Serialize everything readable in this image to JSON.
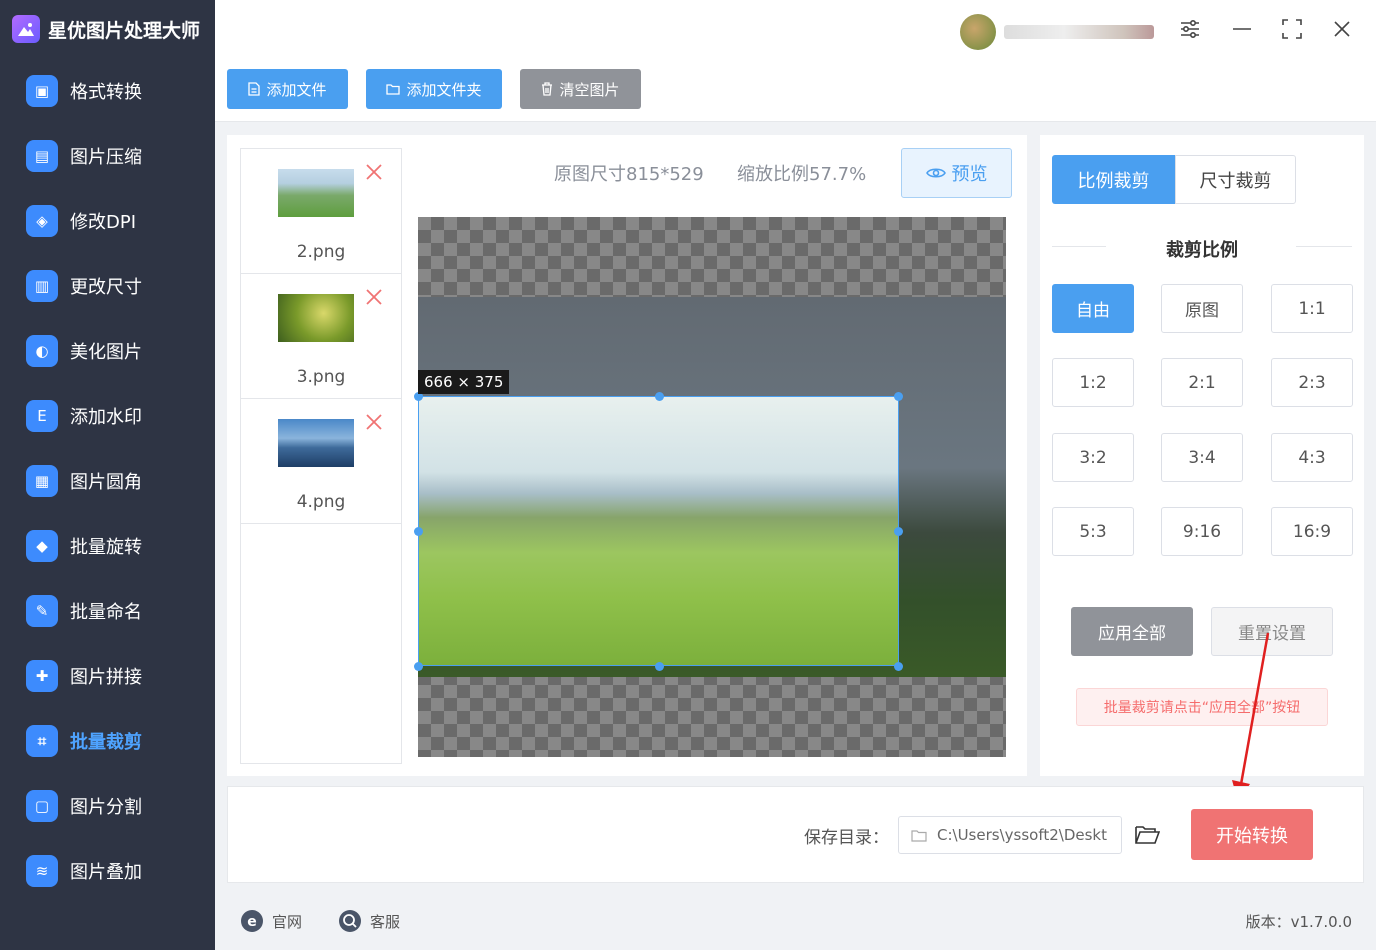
{
  "app": {
    "title": "星优图片处理大师"
  },
  "sidebar": {
    "items": [
      {
        "label": "格式转换",
        "icon": "image-convert-icon",
        "color": "#3d8bfd"
      },
      {
        "label": "图片压缩",
        "icon": "compress-icon",
        "color": "#3d8bfd"
      },
      {
        "label": "修改DPI",
        "icon": "dpi-icon",
        "color": "#3d8bfd"
      },
      {
        "label": "更改尺寸",
        "icon": "resize-icon",
        "color": "#3d8bfd"
      },
      {
        "label": "美化图片",
        "icon": "beautify-icon",
        "color": "#3d8bfd"
      },
      {
        "label": "添加水印",
        "icon": "watermark-icon",
        "color": "#3d8bfd"
      },
      {
        "label": "图片圆角",
        "icon": "round-corner-icon",
        "color": "#3d8bfd"
      },
      {
        "label": "批量旋转",
        "icon": "rotate-icon",
        "color": "#3d8bfd"
      },
      {
        "label": "批量命名",
        "icon": "rename-icon",
        "color": "#3d8bfd"
      },
      {
        "label": "图片拼接",
        "icon": "puzzle-icon",
        "color": "#3d8bfd"
      },
      {
        "label": "批量裁剪",
        "icon": "crop-icon",
        "color": "#3d8bfd",
        "active": true
      },
      {
        "label": "图片分割",
        "icon": "split-icon",
        "color": "#3d8bfd"
      },
      {
        "label": "图片叠加",
        "icon": "layers-icon",
        "color": "#3d8bfd"
      }
    ]
  },
  "toolbar": {
    "add_file": "添加文件",
    "add_folder": "添加文件夹",
    "clear": "清空图片"
  },
  "files": [
    {
      "name": "2.png"
    },
    {
      "name": "3.png"
    },
    {
      "name": "4.png"
    }
  ],
  "editor": {
    "original_size": "原图尺寸815*529",
    "zoom": "缩放比例57.7%",
    "preview": "预览",
    "crop_size_label": "666 × 375"
  },
  "crop_panel": {
    "tab_ratio": "比例裁剪",
    "tab_size": "尺寸裁剪",
    "section_title": "裁剪比例",
    "ratios": [
      "自由",
      "原图",
      "1:1",
      "1:2",
      "2:1",
      "2:3",
      "3:2",
      "3:4",
      "4:3",
      "5:3",
      "9:16",
      "16:9"
    ],
    "apply_all": "应用全部",
    "reset": "重置设置",
    "hint": "批量裁剪请点击“应用全部”按钮"
  },
  "bottom": {
    "save_label": "保存目录：",
    "save_path": "C:\\Users\\yssoft2\\Deskt",
    "start": "开始转换"
  },
  "footer": {
    "website": "官网",
    "service": "客服",
    "version": "版本：v1.7.0.0"
  },
  "colors": {
    "accent": "#4a9ff0",
    "start": "#f07373",
    "sidebar": "#2e3444"
  }
}
